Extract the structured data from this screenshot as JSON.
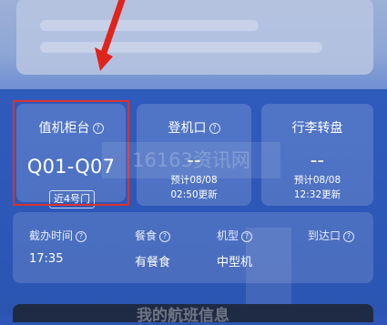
{
  "checkin": {
    "title": "值机柜台",
    "value": "Q01-Q07",
    "gate_hint": "近4号门"
  },
  "boarding": {
    "title": "登机口",
    "value": "--",
    "est": "预计08/08",
    "update": "02:50更新"
  },
  "baggage": {
    "title": "行李转盘",
    "value": "--",
    "est": "预计08/08",
    "update": "12:32更新"
  },
  "info": [
    {
      "label": "截办时间",
      "value": "17:35"
    },
    {
      "label": "餐食",
      "value": "有餐食"
    },
    {
      "label": "机型",
      "value": "中型机"
    },
    {
      "label": "到达口",
      "value": ""
    }
  ],
  "section_title": "我的航班信息",
  "help_glyph": "?",
  "watermark": "16163资讯网",
  "colors": {
    "panel": "#2f56b6",
    "highlight": "#d9322e",
    "arrow": "#e0241c"
  }
}
